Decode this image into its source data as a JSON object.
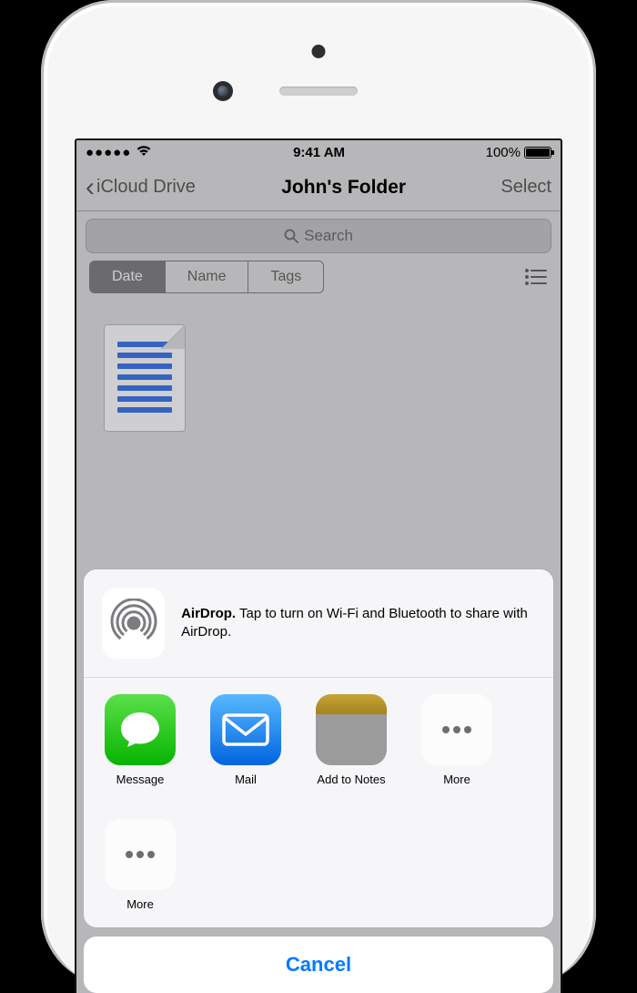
{
  "status": {
    "time": "9:41 AM",
    "battery_pct": "100%"
  },
  "nav": {
    "back_label": "iCloud Drive",
    "title": "John's Folder",
    "action": "Select"
  },
  "search": {
    "placeholder": "Search"
  },
  "filters": {
    "tabs": [
      "Date",
      "Name",
      "Tags"
    ],
    "active_index": 0
  },
  "share": {
    "airdrop": {
      "title": "AirDrop.",
      "hint": "Tap to turn on Wi-Fi and Bluetooth to share with AirDrop."
    },
    "app_row": [
      {
        "label": "Message",
        "key": "message"
      },
      {
        "label": "Mail",
        "key": "mail"
      },
      {
        "label": "Add to Notes",
        "key": "notes"
      },
      {
        "label": "More",
        "key": "more"
      }
    ],
    "action_row": [
      {
        "label": "More",
        "key": "more"
      }
    ],
    "cancel": "Cancel"
  }
}
